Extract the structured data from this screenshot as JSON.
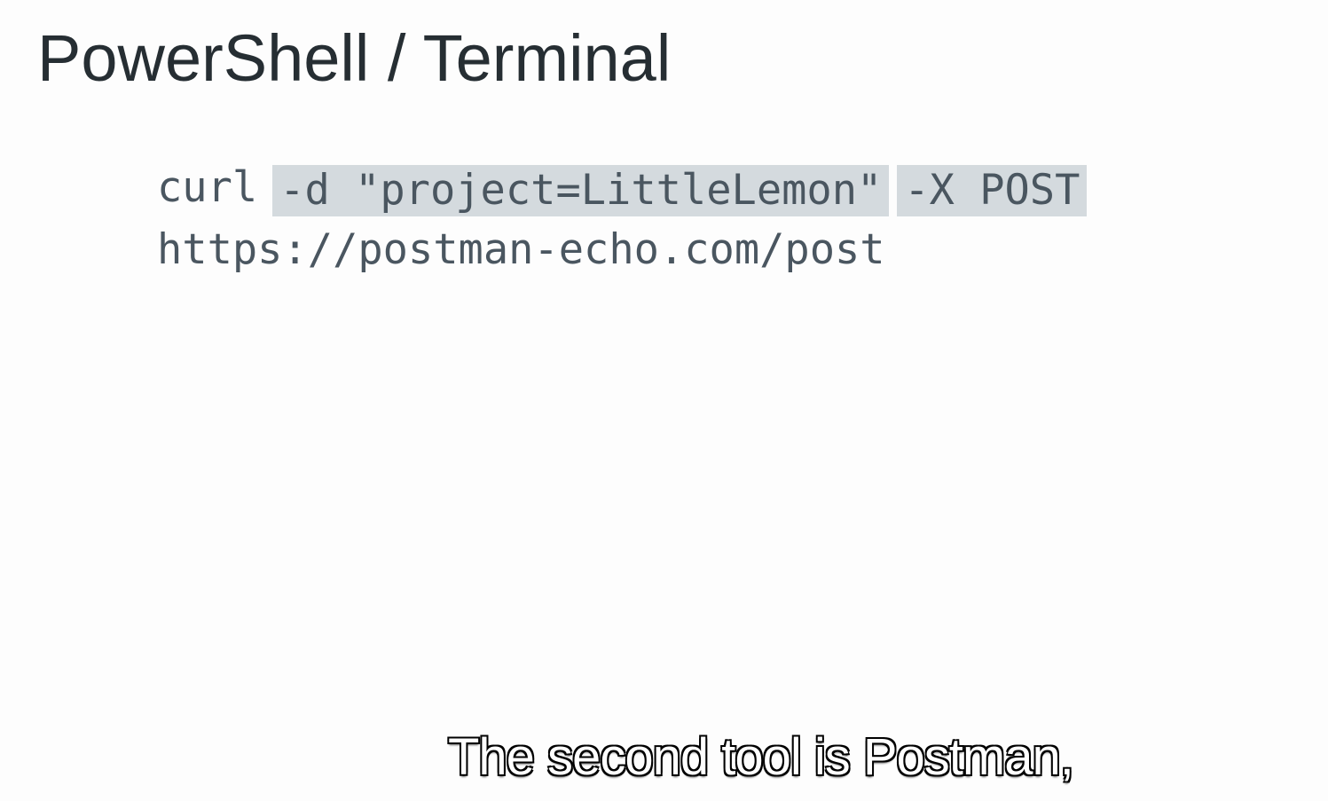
{
  "slide": {
    "title": "PowerShell / Terminal",
    "code": {
      "line1": {
        "command": "curl",
        "data_flag": "-d \"project=LittleLemon\"",
        "method_flag": "-X POST"
      },
      "line2": {
        "url": "https://postman-echo.com/post"
      }
    },
    "highlight_color": "#d4dade",
    "text_color": "#4a5660"
  },
  "caption": {
    "text": "The second tool is Postman,"
  }
}
